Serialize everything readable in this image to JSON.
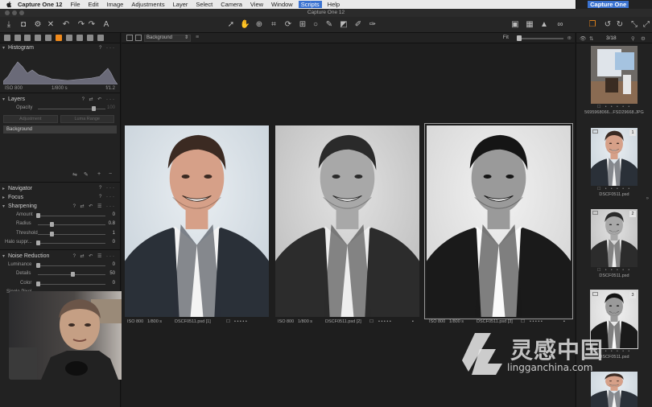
{
  "menubar": {
    "app_name": "Capture One 12",
    "items": [
      "File",
      "Edit",
      "Image",
      "Adjustments",
      "Layer",
      "Select",
      "Camera",
      "View",
      "Window",
      "Scripts",
      "Help"
    ],
    "highlighted": "Scripts",
    "right_brand": "Capture One"
  },
  "window": {
    "title": "Capture One 12"
  },
  "left_panel": {
    "histogram": {
      "title": "Histogram",
      "iso": "ISO 800",
      "shutter": "1/800 s",
      "aperture": "f/1.2"
    },
    "layers": {
      "title": "Layers",
      "opacity_label": "Opacity",
      "opacity_value": "100",
      "adjustment_btn": "Adjustment",
      "luma_btn": "Luma Range",
      "background_layer": "Background"
    },
    "navigator": {
      "title": "Navigator"
    },
    "focus": {
      "title": "Focus"
    },
    "sharpening": {
      "title": "Sharpening",
      "rows": [
        {
          "label": "Amount",
          "value": "0",
          "level": 0.0
        },
        {
          "label": "Radius",
          "value": "0.8",
          "level": 0.2
        },
        {
          "label": "Threshold",
          "value": "1",
          "level": 0.2
        },
        {
          "label": "Halo suppr...",
          "value": "0",
          "level": 0.0
        }
      ]
    },
    "noise_reduction": {
      "title": "Noise Reduction",
      "rows": [
        {
          "label": "Luminance",
          "value": "0",
          "level": 0.0
        },
        {
          "label": "Details",
          "value": "50",
          "level": 0.5
        },
        {
          "label": "Color",
          "value": "0",
          "level": 0.0
        },
        {
          "label": "Single Pixel",
          "value": "",
          "level": 0.0
        }
      ]
    }
  },
  "viewer": {
    "layer_select": "Background",
    "fit_label": "Fit",
    "images": [
      {
        "iso": "ISO 800",
        "shutter": "1/800 s",
        "name": "DSCF0511.psd [1]",
        "variant": "color"
      },
      {
        "iso": "ISO 800",
        "shutter": "1/800 s",
        "name": "DSCF0511.psd [2]",
        "variant": "bw"
      },
      {
        "iso": "ISO 800",
        "shutter": "1/800 s",
        "name": "DSCF0511.psd [3]",
        "variant": "bw-contrast"
      }
    ],
    "stars": "• • • • •"
  },
  "browser": {
    "count": "3/18",
    "thumbs": [
      {
        "name": "5695968066...FSD29668.JPG",
        "badge": "",
        "variant": "room"
      },
      {
        "name": "DSCF0511.psd",
        "badge": "1",
        "variant": "color"
      },
      {
        "name": "DSCF0511.psd",
        "badge": "2",
        "variant": "bw"
      },
      {
        "name": "DSCF0511.psd",
        "badge": "3",
        "variant": "bw-contrast"
      },
      {
        "name": "",
        "badge": "",
        "variant": "color"
      }
    ],
    "stars": "• • • • •"
  },
  "watermark": {
    "cn": "灵感中国",
    "en": "lingganchina.com"
  },
  "colors": {
    "accent": "#f08a1c",
    "menu_highlight": "#3b73d1"
  }
}
